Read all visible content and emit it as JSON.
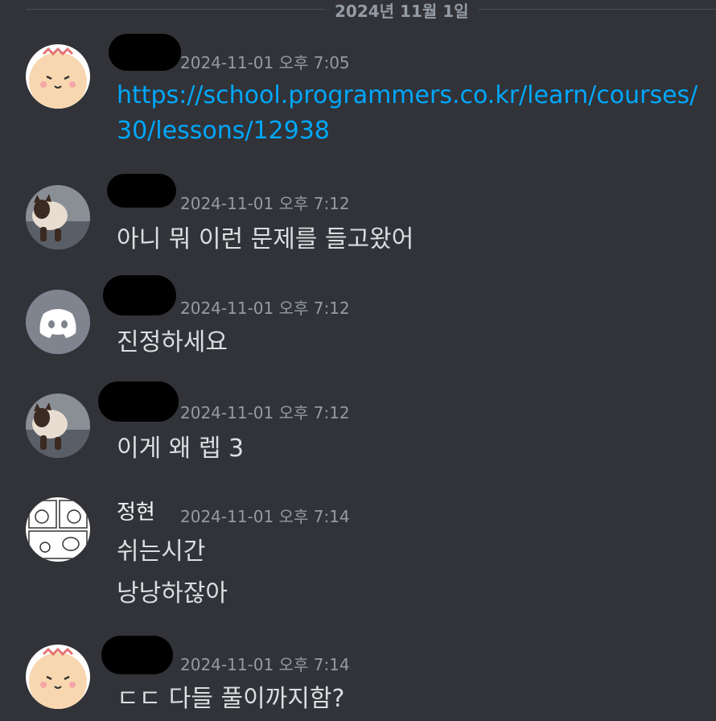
{
  "date_divider": "2024년 11월 1일",
  "messages": [
    {
      "avatar": "hamster-avatar",
      "timestamp": "2024-11-01 오후 7:05",
      "link_line1": "https://school.programmers.co.kr/learn/courses/",
      "link_line2": "30/lessons/12938"
    },
    {
      "avatar": "cat-photo-avatar",
      "timestamp": "2024-11-01 오후 7:12",
      "text": "아니 뭐 이런 문제를 들고왔어"
    },
    {
      "avatar": "discord-default-avatar",
      "timestamp": "2024-11-01 오후 7:12",
      "text": "진정하세요"
    },
    {
      "avatar": "cat-photo-avatar",
      "timestamp": "2024-11-01 오후 7:12",
      "text": "이게 왜 렙 3"
    },
    {
      "avatar": "comic-avatar",
      "username": "정현",
      "timestamp": "2024-11-01 오후 7:14",
      "text1": "쉬는시간",
      "text2": "낭낭하잖아"
    },
    {
      "avatar": "hamster-avatar",
      "timestamp": "2024-11-01 오후 7:14",
      "text": "ㄷㄷ 다들 풀이까지함?"
    }
  ],
  "colors": {
    "background": "#313338",
    "link": "#00a8fc",
    "timestamp": "#949ba4",
    "discord_blurple": "#5865f2"
  }
}
